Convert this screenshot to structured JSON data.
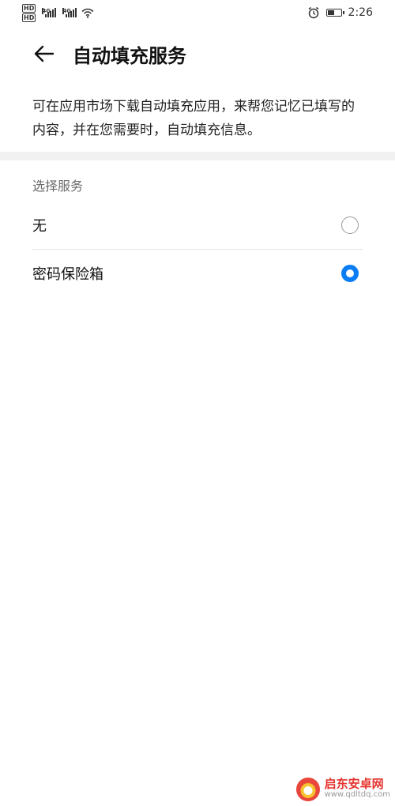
{
  "status_bar": {
    "hd1": "HD",
    "hd2": "HD",
    "net1": "4G",
    "net2": "4G",
    "time": "2:26",
    "battery_level": 0.55,
    "icons": [
      "hd-icon",
      "signal-icon",
      "wifi-icon",
      "alarm-icon",
      "battery-icon"
    ]
  },
  "header": {
    "title": "自动填充服务",
    "back_icon": "arrow-left-icon"
  },
  "description": "可在应用市场下载自动填充应用，来帮您记忆已填写的内容，并在您需要时，自动填充信息。",
  "section": {
    "title": "选择服务",
    "options": [
      {
        "label": "无",
        "selected": false
      },
      {
        "label": "密码保险箱",
        "selected": true
      }
    ]
  },
  "colors": {
    "accent": "#0a7df5",
    "section_header": "#6b6b6b",
    "divider_band": "#f1f1f1"
  },
  "watermark": {
    "name": "启东安卓网",
    "url": "www.qdltdq.com"
  }
}
